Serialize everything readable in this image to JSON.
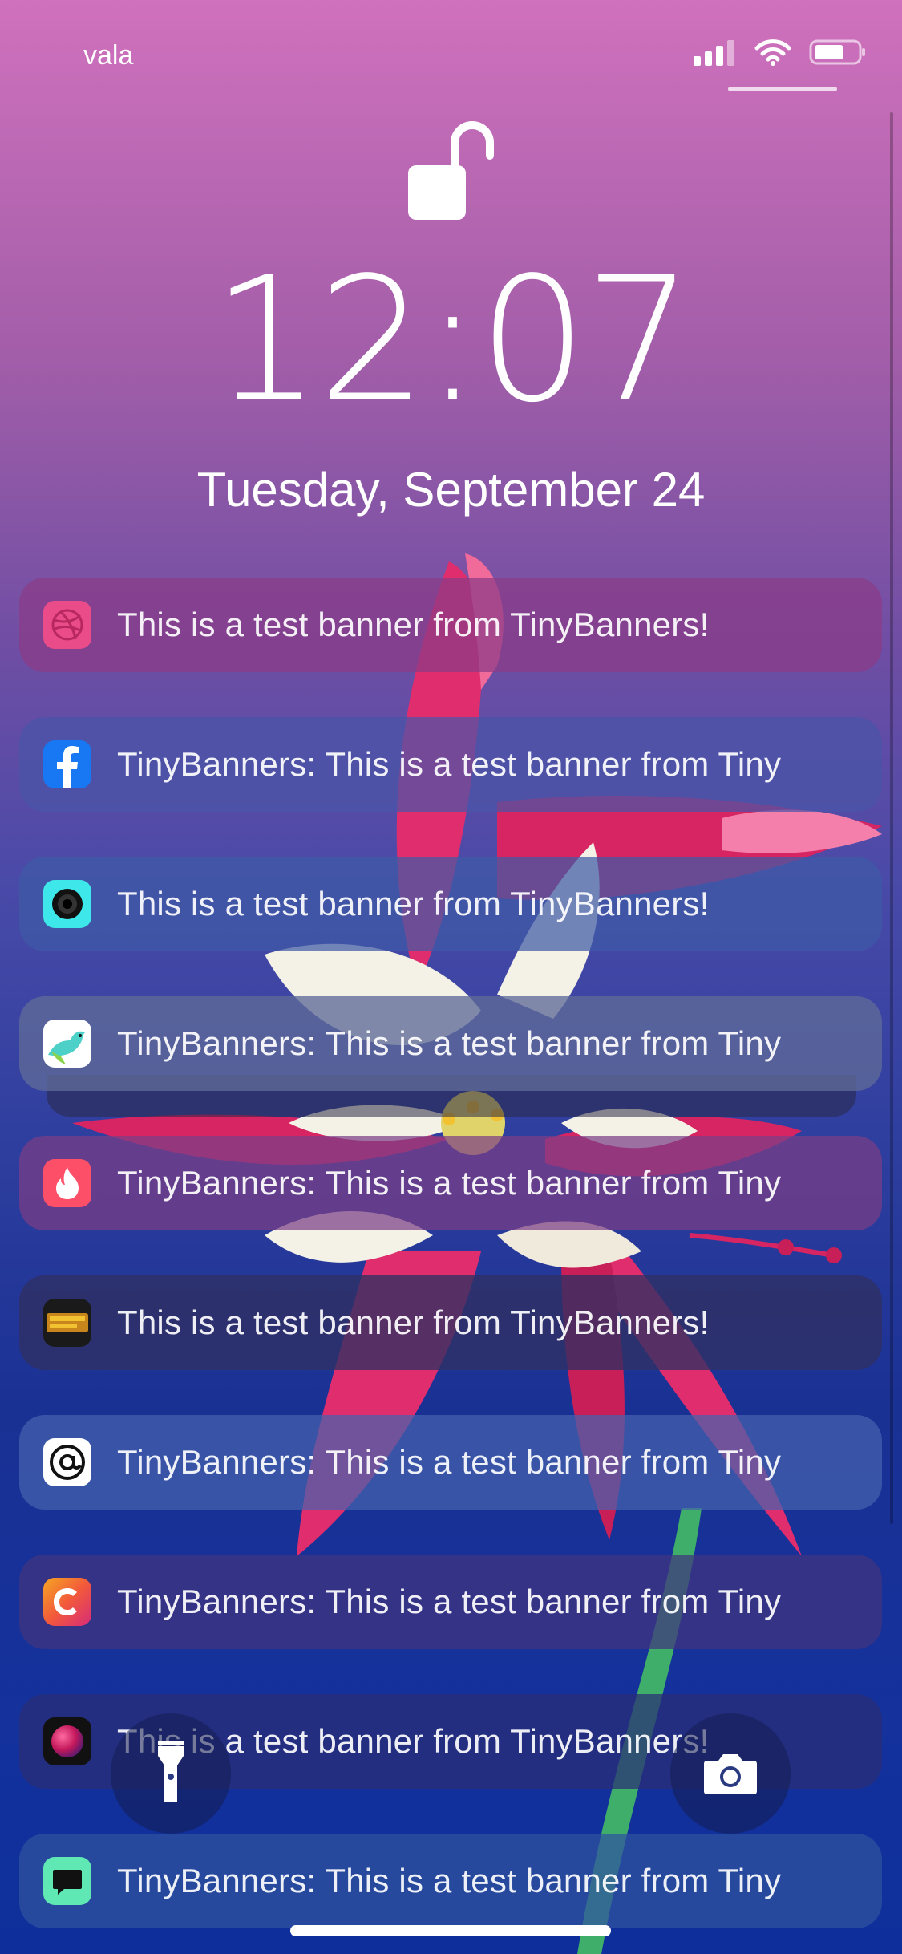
{
  "status_bar": {
    "carrier": "vala",
    "signal_icon": "cellular-signal-icon",
    "wifi_icon": "wifi-icon",
    "battery_icon": "battery-icon"
  },
  "lock": {
    "icon": "unlocked-padlock-icon",
    "time": "12:07",
    "date": "Tuesday, September 24"
  },
  "notifications": [
    {
      "app_icon": "dribbble-icon",
      "text": "This is a test banner from TinyBanners!",
      "bg": "#8a3b86",
      "icon_bg": "#ea4c89"
    },
    {
      "app_icon": "facebook-icon",
      "text": "TinyBanners: This is a test banner from Tiny",
      "bg": "#4a55a8",
      "icon_bg": "#1877f2"
    },
    {
      "app_icon": "camera-lens-icon",
      "text": "This is a test banner from TinyBanners!",
      "bg": "#3f5aa6",
      "icon_bg": "#3ee8ea"
    },
    {
      "app_icon": "bird-app-icon",
      "text": "TinyBanners: This is a test banner from Tiny",
      "bg": "#5f6a98",
      "icon_bg": "#ffffff"
    },
    {
      "app_icon": "tinder-flame-icon",
      "text": "TinyBanners: This is a test banner from Tiny",
      "bg": "#7a3e86",
      "icon_bg": "#fd5068"
    },
    {
      "app_icon": "wolf-among-us-icon",
      "text": "This is a test banner from TinyBanners!",
      "bg": "#2f2f63",
      "icon_bg": "#1a1a1a"
    },
    {
      "app_icon": "at-sign-icon",
      "text": "TinyBanners: This is a test banner from Tiny",
      "bg": "#4563ad",
      "icon_bg": "#ffffff"
    },
    {
      "app_icon": "c-logo-icon",
      "text": "TinyBanners: This is a test banner from Tiny",
      "bg": "#41357e",
      "icon_bg": "#f25a3a"
    },
    {
      "app_icon": "gradient-orb-icon",
      "text": "This is a test banner from TinyBanners!",
      "bg": "#2a2e76",
      "icon_bg": "#111111"
    },
    {
      "app_icon": "chat-bubble-icon",
      "text": "TinyBanners: This is a test banner from Tiny",
      "bg": "#2f539f",
      "icon_bg": "#5fe8b4"
    }
  ],
  "quick_actions": {
    "flashlight_icon": "flashlight-icon",
    "camera_icon": "camera-icon"
  }
}
